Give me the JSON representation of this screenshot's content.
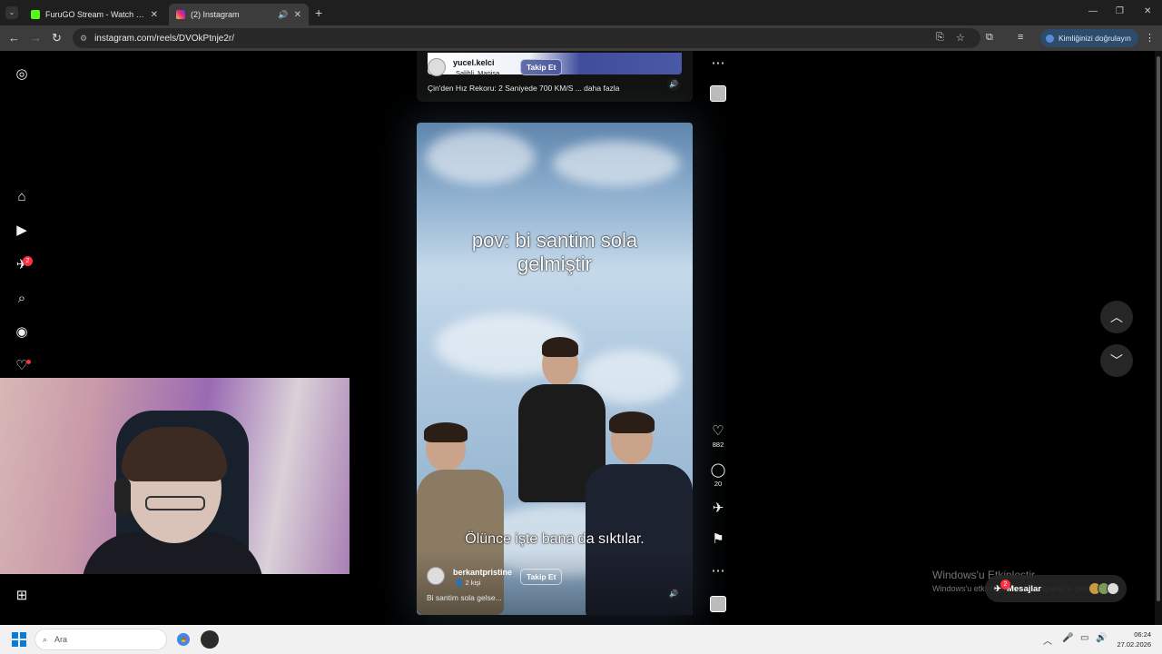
{
  "browser": {
    "tabs": [
      {
        "title": "FuruGO Stream - Watch Live on",
        "active": false,
        "favicon_color": "#53fc18"
      },
      {
        "title": "(2) Instagram",
        "active": true,
        "favicon_color": "#e1306c"
      }
    ],
    "url": "instagram.com/reels/DVOkPtnje2r/",
    "verify_label": "Kimliğinizi doğrulayın"
  },
  "sidebar": {
    "notifications_badge": "2"
  },
  "reels": {
    "prev": {
      "username": "yucel.kelci",
      "location": "Salihli, Manisa",
      "follow_label": "Takip Et",
      "caption": "Çin'den Hız Rekoru: 2 Saniyede 700 KM/S ... daha fazla"
    },
    "current": {
      "overlay_top": [
        "pov: bi santim sola",
        "gelmiştir"
      ],
      "overlay_bottom": "Ölünce işte bana da sıktılar.",
      "username": "berkantpristine",
      "collab": "2 kişi",
      "follow_label": "Takip Et",
      "caption": "Bi santim sola gelse..."
    },
    "likes": "882",
    "comments": "20"
  },
  "windows_watermark": {
    "line1": "Windows'u Etkinleştir",
    "line2": "Windows'u etkinleştirmek için Ayarlar'a gidin."
  },
  "messages": {
    "label": "Mesajlar",
    "badge": "2"
  },
  "taskbar": {
    "search_placeholder": "Ara",
    "time": "06:24",
    "date": "27.02.2026"
  }
}
